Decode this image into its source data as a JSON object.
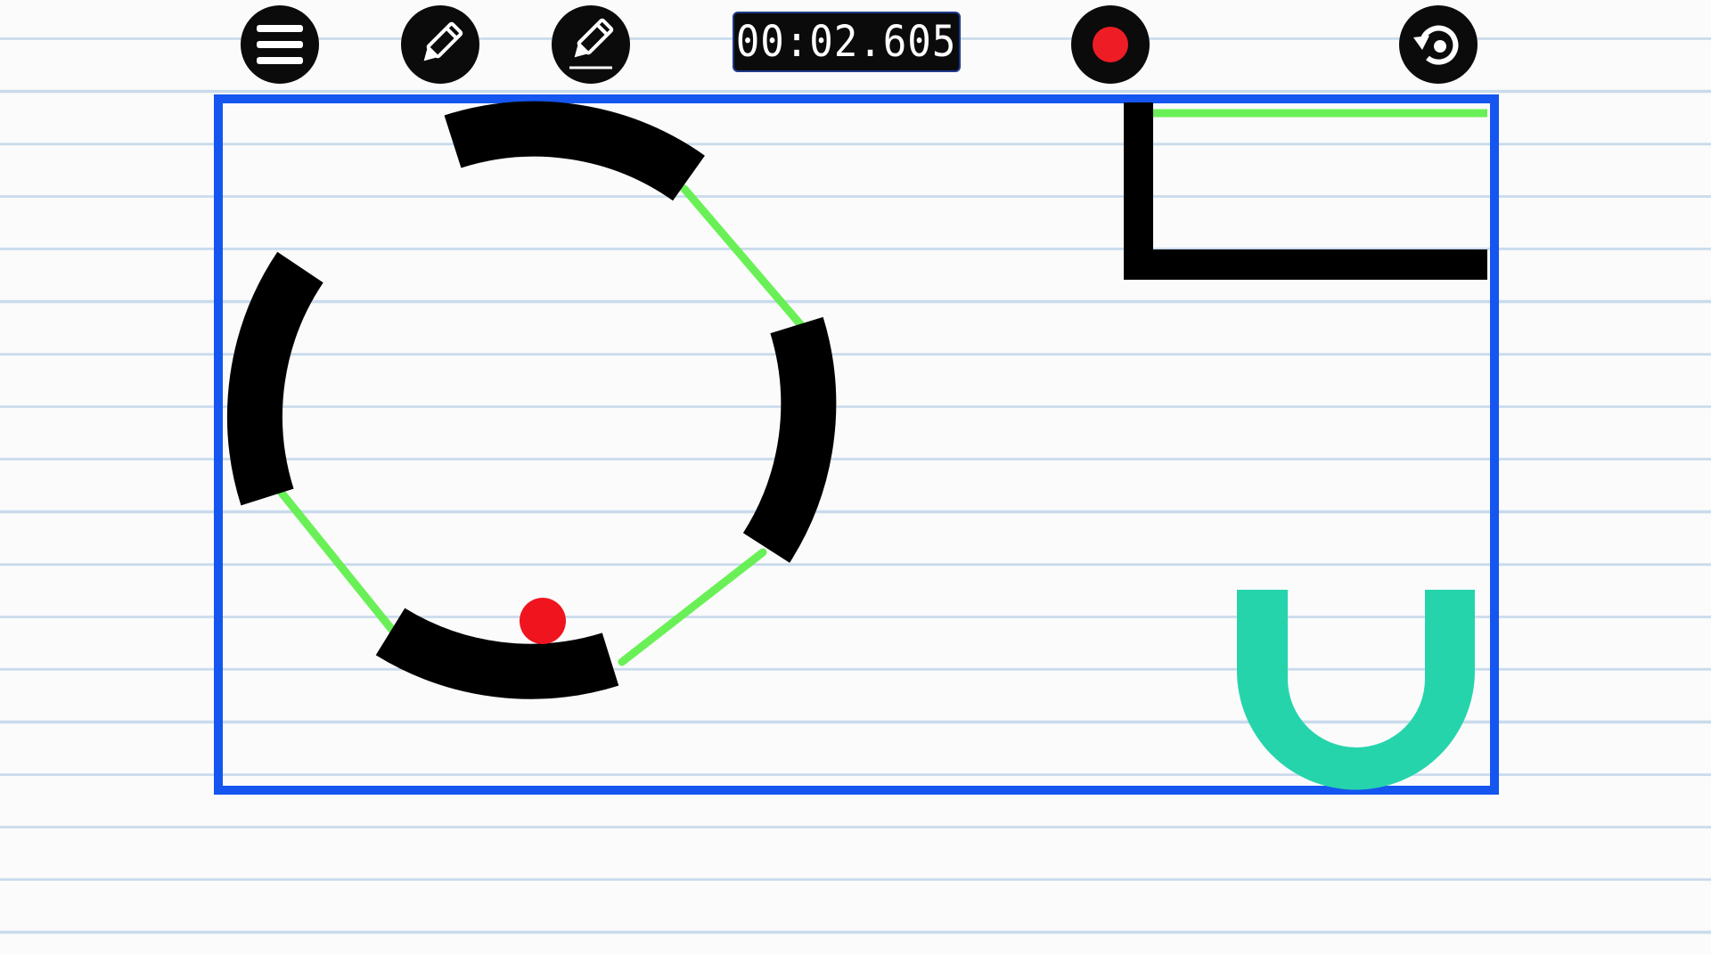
{
  "toolbar": {
    "menu_icon": "menu-icon",
    "pencil_icon": "pencil-icon",
    "eraser_icon": "eraser-icon",
    "record_icon": "record-icon",
    "restart_icon": "restart-icon"
  },
  "timer": {
    "value": "00:02.605"
  },
  "colors": {
    "frame": "#1556f0",
    "wall": "#000000",
    "drawn_line": "#5ef04a",
    "ball": "#f0141e",
    "goal_cup": "#26d4ac",
    "record_dot": "#ee1c25",
    "timer_border": "#1e3a8a"
  }
}
